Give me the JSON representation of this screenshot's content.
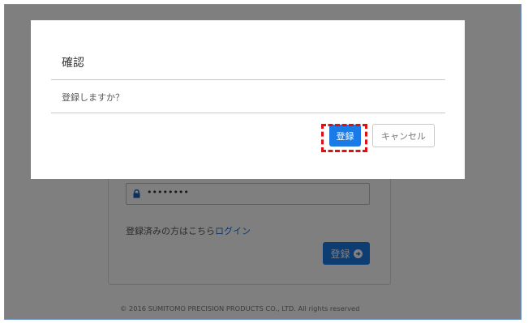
{
  "background_form": {
    "password_mask": "••••••••",
    "login_prompt": "登録済みの方はこちら",
    "login_link": "ログイン",
    "register_button": "登録",
    "footer": "© 2016 SUMITOMO PRECISION PRODUCTS CO., LTD. All rights reserved"
  },
  "dialog": {
    "title": "確認",
    "message": "登録しますか？",
    "confirm_button": "登録",
    "cancel_button": "キャンセル"
  },
  "colors": {
    "primary": "#1a7be6",
    "highlight": "#e01010",
    "overlay": "rgba(0,0,0,0.5)"
  }
}
